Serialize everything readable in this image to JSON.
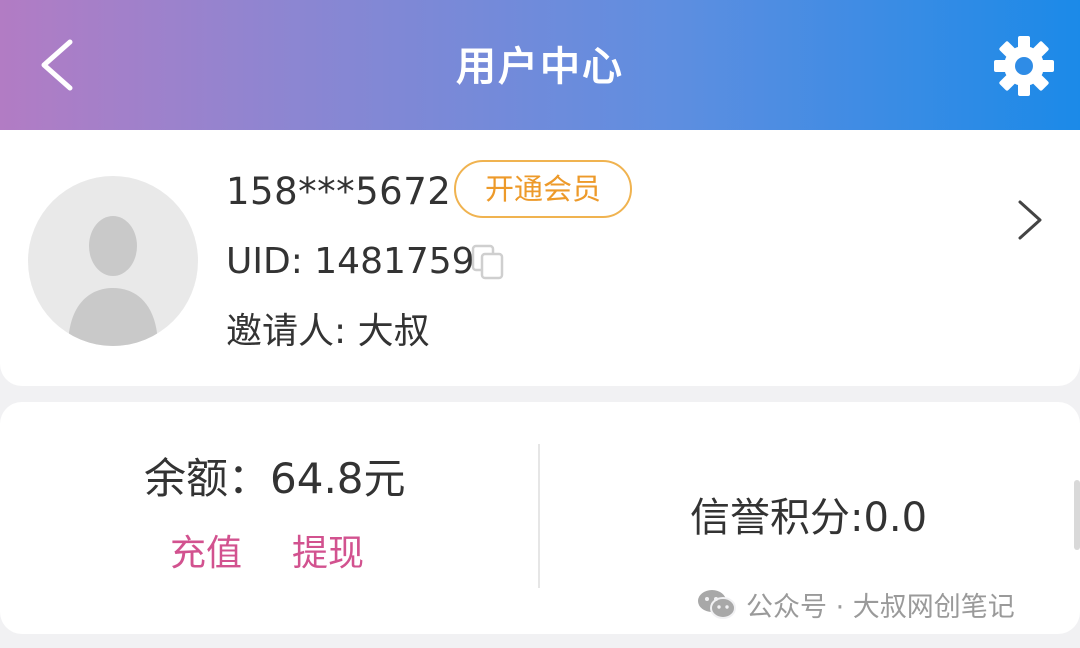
{
  "header": {
    "title": "用户中心",
    "back_icon": "chevron-left-icon",
    "settings_icon": "gear-icon"
  },
  "profile": {
    "phone": "158***5672",
    "vip_label": "开通会员",
    "uid_text": "UID: 1481759",
    "inviter_text": "邀请人: 大叔",
    "avatar_icon": "user-avatar-icon",
    "copy_icon": "copy-icon",
    "detail_icon": "chevron-right-icon"
  },
  "wallet": {
    "balance_text": "余额：64.8元",
    "recharge_label": "充值",
    "withdraw_label": "提现",
    "credit_text": "信誉积分:0.0"
  },
  "watermark": {
    "text": "公众号 · 大叔网创笔记",
    "icon": "wechat-icon"
  },
  "colors": {
    "header_gradient_start": "#b27cc4",
    "header_gradient_end": "#1b8ae8",
    "vip_border": "#f0b350",
    "vip_text": "#ed9a2a",
    "action_link": "#d2528f",
    "text_primary": "#333333"
  }
}
